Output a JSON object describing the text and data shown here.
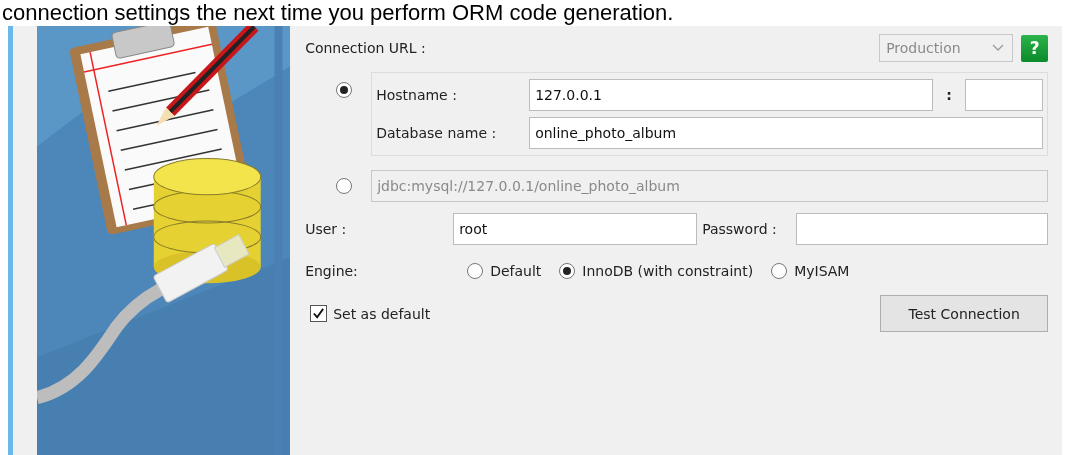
{
  "intro_text": "connection settings the next time you perform ORM code generation.",
  "connection_url": {
    "label": "Connection URL :",
    "environment": "Production",
    "help": "?"
  },
  "hostname_mode": {
    "selected": true,
    "hostname_label": "Hostname :",
    "hostname": "127.0.0.1",
    "port_separator": ":",
    "database_label": "Database name :",
    "database": "online_photo_album"
  },
  "url_mode": {
    "selected": false,
    "disabled": true,
    "url": "jdbc:mysql://127.0.0.1/online_photo_album"
  },
  "user": {
    "label": "User :",
    "value": "root"
  },
  "password": {
    "label": "Password :"
  },
  "engine": {
    "label": "Engine:",
    "options": [
      {
        "label": "Default",
        "selected": false
      },
      {
        "label": "InnoDB (with constraint)",
        "selected": true
      },
      {
        "label": "MyISAM",
        "selected": false
      }
    ]
  },
  "set_as_default": {
    "label": "Set as default",
    "checked": true
  },
  "test_button": "Test Connection"
}
